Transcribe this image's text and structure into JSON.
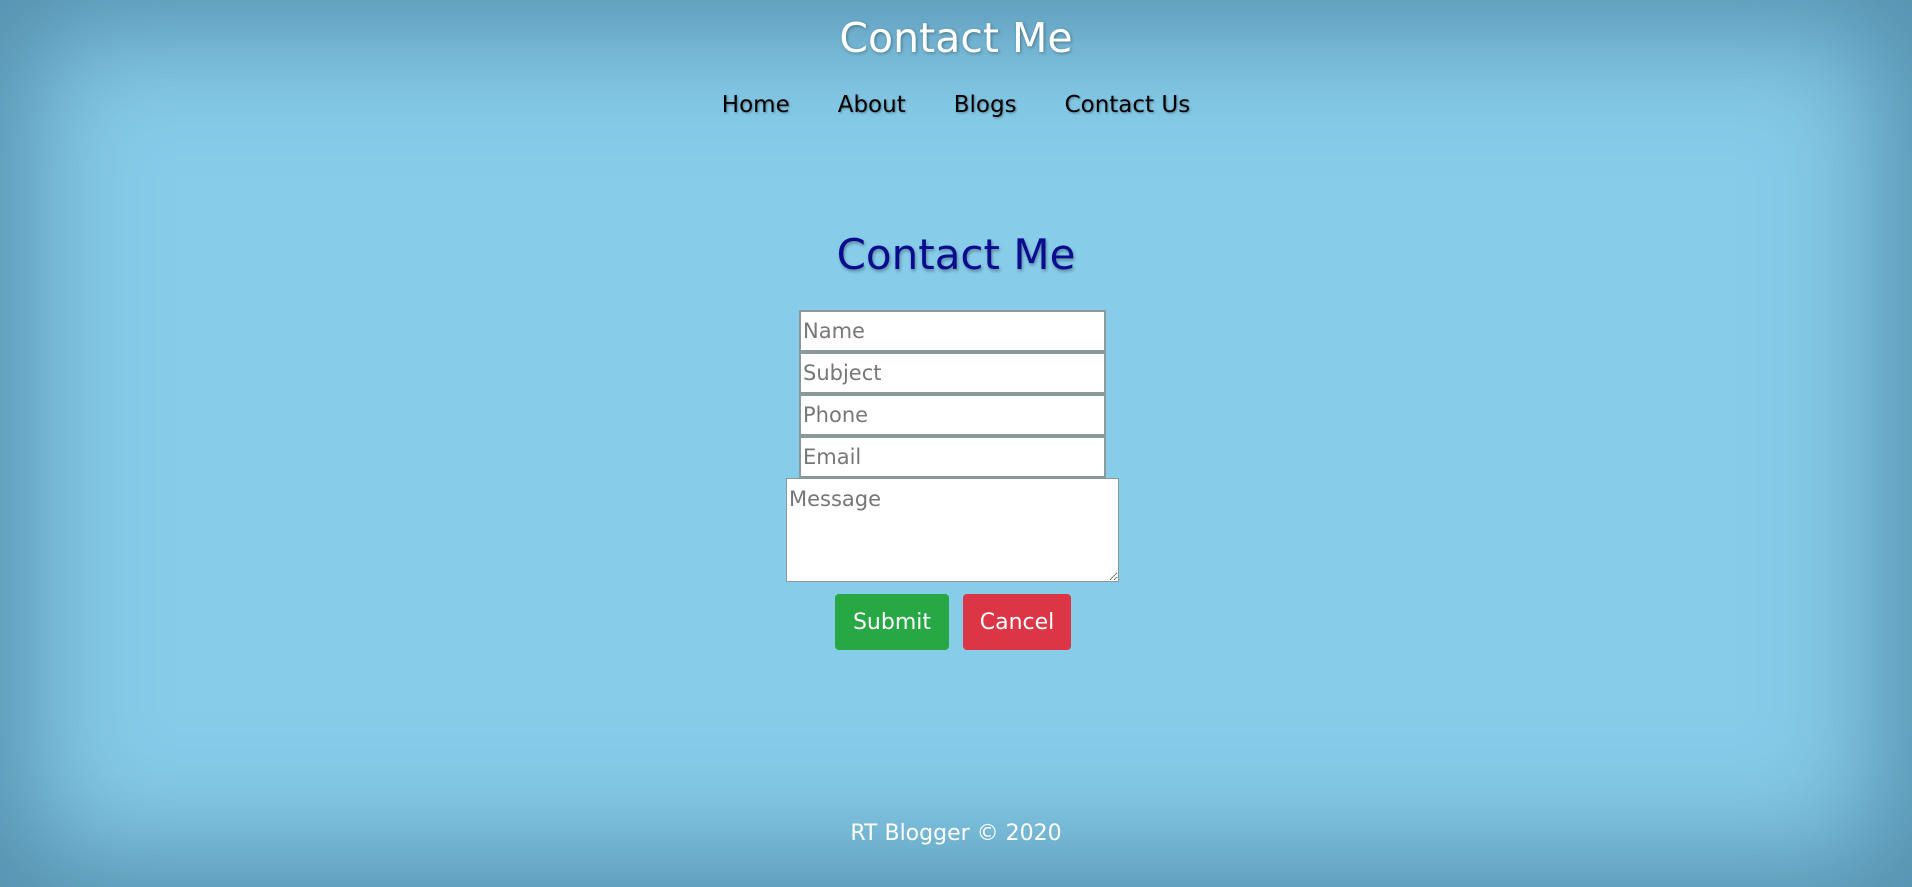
{
  "header": {
    "title": "Contact Me"
  },
  "nav": {
    "items": [
      {
        "label": "Home"
      },
      {
        "label": "About"
      },
      {
        "label": "Blogs"
      },
      {
        "label": "Contact Us"
      }
    ]
  },
  "main": {
    "heading": "Contact Me",
    "form": {
      "name_placeholder": "Name",
      "subject_placeholder": "Subject",
      "phone_placeholder": "Phone",
      "email_placeholder": "Email",
      "message_placeholder": "Message",
      "submit_label": "Submit",
      "cancel_label": "Cancel"
    }
  },
  "footer": {
    "text": "RT Blogger © 2020"
  },
  "colors": {
    "background": "#87cdea",
    "heading": "#0b0b8f",
    "submit": "#28a745",
    "cancel": "#dc3545"
  }
}
